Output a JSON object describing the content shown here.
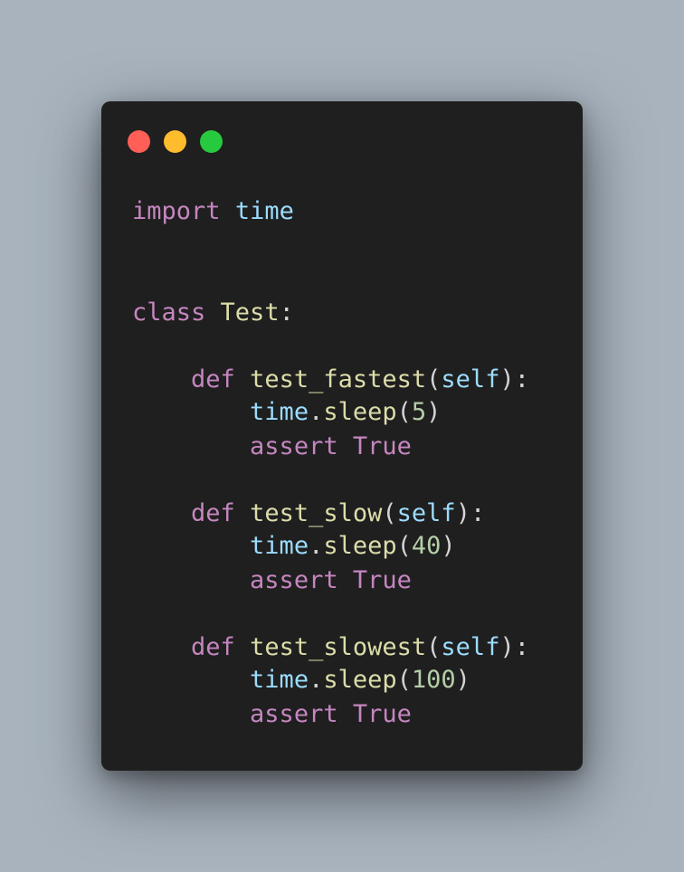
{
  "window": {
    "controls": [
      {
        "name": "close",
        "color": "#ff5f56"
      },
      {
        "name": "minimize",
        "color": "#ffbd2e"
      },
      {
        "name": "maximize",
        "color": "#27c93f"
      }
    ]
  },
  "code": {
    "line1": {
      "kw": "import",
      "sp": " ",
      "mod": "time"
    },
    "line2": {
      "kw": "class",
      "sp": " ",
      "name": "Test",
      "colon": ":"
    },
    "func1": {
      "indent": "    ",
      "kw": "def",
      "sp": " ",
      "name": "test_fastest",
      "open": "(",
      "self": "self",
      "close": "):"
    },
    "sleep1": {
      "indent": "        ",
      "obj": "time",
      "dot": ".",
      "fn": "sleep",
      "open": "(",
      "num": "5",
      "close": ")"
    },
    "assert1": {
      "indent": "        ",
      "kw": "assert",
      "sp": " ",
      "val": "True"
    },
    "func2": {
      "indent": "    ",
      "kw": "def",
      "sp": " ",
      "name": "test_slow",
      "open": "(",
      "self": "self",
      "close": "):"
    },
    "sleep2": {
      "indent": "        ",
      "obj": "time",
      "dot": ".",
      "fn": "sleep",
      "open": "(",
      "num": "40",
      "close": ")"
    },
    "assert2": {
      "indent": "        ",
      "kw": "assert",
      "sp": " ",
      "val": "True"
    },
    "func3": {
      "indent": "    ",
      "kw": "def",
      "sp": " ",
      "name": "test_slowest",
      "open": "(",
      "self": "self",
      "close": "):"
    },
    "sleep3": {
      "indent": "        ",
      "obj": "time",
      "dot": ".",
      "fn": "sleep",
      "open": "(",
      "num": "100",
      "close": ")"
    },
    "assert3": {
      "indent": "        ",
      "kw": "assert",
      "sp": " ",
      "val": "True"
    }
  }
}
